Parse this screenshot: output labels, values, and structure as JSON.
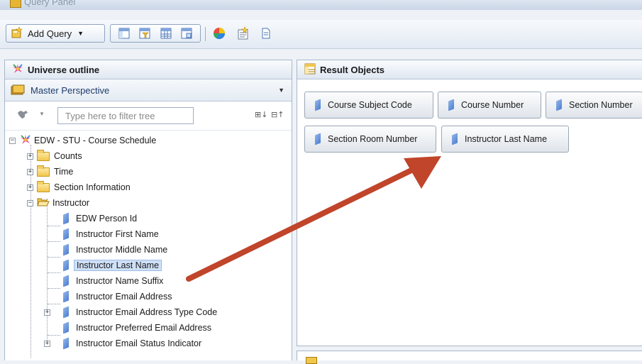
{
  "window": {
    "title": "Query Panel"
  },
  "toolbar": {
    "add_query_label": "Add Query"
  },
  "universe_outline": {
    "title": "Universe outline",
    "perspective": "Master Perspective",
    "filter_placeholder": "Type here to filter tree",
    "root": "EDW - STU - Course Schedule",
    "folders": [
      "Counts",
      "Time",
      "Section Information",
      "Instructor"
    ],
    "instructor_items": [
      "EDW Person Id",
      "Instructor First Name",
      "Instructor Middle Name",
      "Instructor Last Name",
      "Instructor Name Suffix",
      "Instructor Email Address",
      "Instructor Email Address Type Code",
      "Instructor Preferred Email Address",
      "Instructor Email Status Indicator"
    ],
    "selected_item": "Instructor Last Name"
  },
  "result_objects": {
    "title": "Result Objects",
    "items": [
      "Course Subject Code",
      "Course Number",
      "Section Number",
      "Section Room Number",
      "Instructor Last Name"
    ]
  },
  "colors": {
    "arrow": "#c0452a",
    "selection": "#cfe0f7",
    "accent": "#4e7fd0"
  }
}
